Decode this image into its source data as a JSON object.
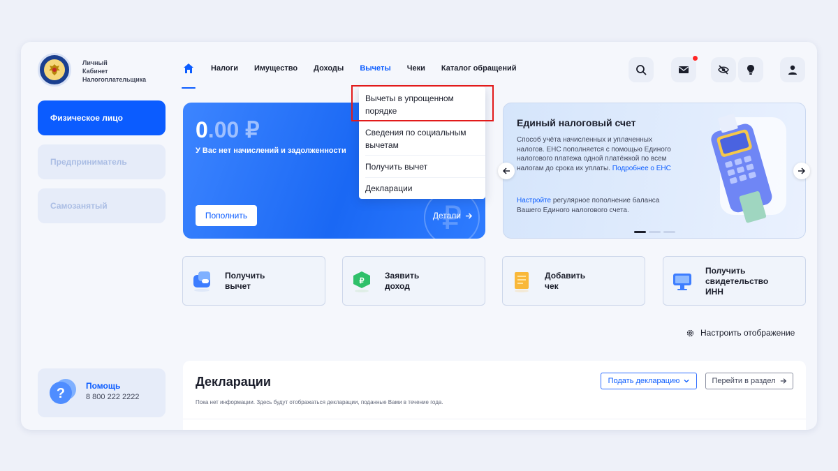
{
  "brand": {
    "line1": "Личный",
    "line2": "Кабинет",
    "line3": "Налогоплательщика"
  },
  "nav": {
    "home_icon": "home-icon",
    "items": [
      "Налоги",
      "Имущество",
      "Доходы",
      "Вычеты",
      "Чеки",
      "Каталог обращений"
    ],
    "active": "Вычеты"
  },
  "header_buttons": [
    "search-icon",
    "mail-icon",
    "eye-off-icon",
    "lightbulb-icon",
    "user-icon"
  ],
  "sidebar": {
    "items": [
      "Физическое лицо",
      "Предприниматель",
      "Самозанятый"
    ],
    "active": "Физическое лицо",
    "help_title": "Помощь",
    "help_phone": "8 800 222 2222"
  },
  "balance": {
    "amount_int": "0",
    "amount_dec": ".00 ₽",
    "status": "У Вас нет начислений и задолженности",
    "topup_label": "Пополнить",
    "details_label": "Детали"
  },
  "promo": {
    "title": "Единый налоговый счет",
    "text": "Способ учёта начисленных и уплаченных налогов. ЕНС пополняется с помощью Единого налогового платежа одной платёжкой по всем налогам до срока их уплаты.",
    "link": "Подробнее о ЕНС",
    "text2_link": "Настройте",
    "text2": " регулярное пополнение баланса Вашего Единого налогового счета.",
    "slides": 3,
    "active_slide": 1
  },
  "quick_actions": [
    {
      "line1": "Получить",
      "line2": "вычет",
      "line3": ""
    },
    {
      "line1": "Заявить",
      "line2": "доход",
      "line3": ""
    },
    {
      "line1": "Добавить",
      "line2": "чек",
      "line3": ""
    },
    {
      "line1": "Получить",
      "line2": "свидетельство",
      "line3": "ИНН"
    }
  ],
  "settings_label": "Настроить отображение",
  "declarations": {
    "title": "Декларации",
    "subtitle": "Пока нет информации. Здесь будут отображаться декларации, поданные Вами в течение года.",
    "submit_label": "Подать декларацию",
    "goto_label": "Перейти в раздел"
  },
  "dropdown": {
    "items": [
      {
        "line1": "Вычеты в упрощенном",
        "line2": "порядке"
      },
      {
        "line1": "Сведения по социальным",
        "line2": "вычетам"
      },
      {
        "line1": "Получить вычет",
        "line2": ""
      },
      {
        "line1": "Декларации",
        "line2": ""
      }
    ],
    "highlighted_index": 0,
    "highlight_color": "#e21a1a"
  },
  "colors": {
    "accent": "#0b5cff",
    "notification": "#ff2626"
  }
}
